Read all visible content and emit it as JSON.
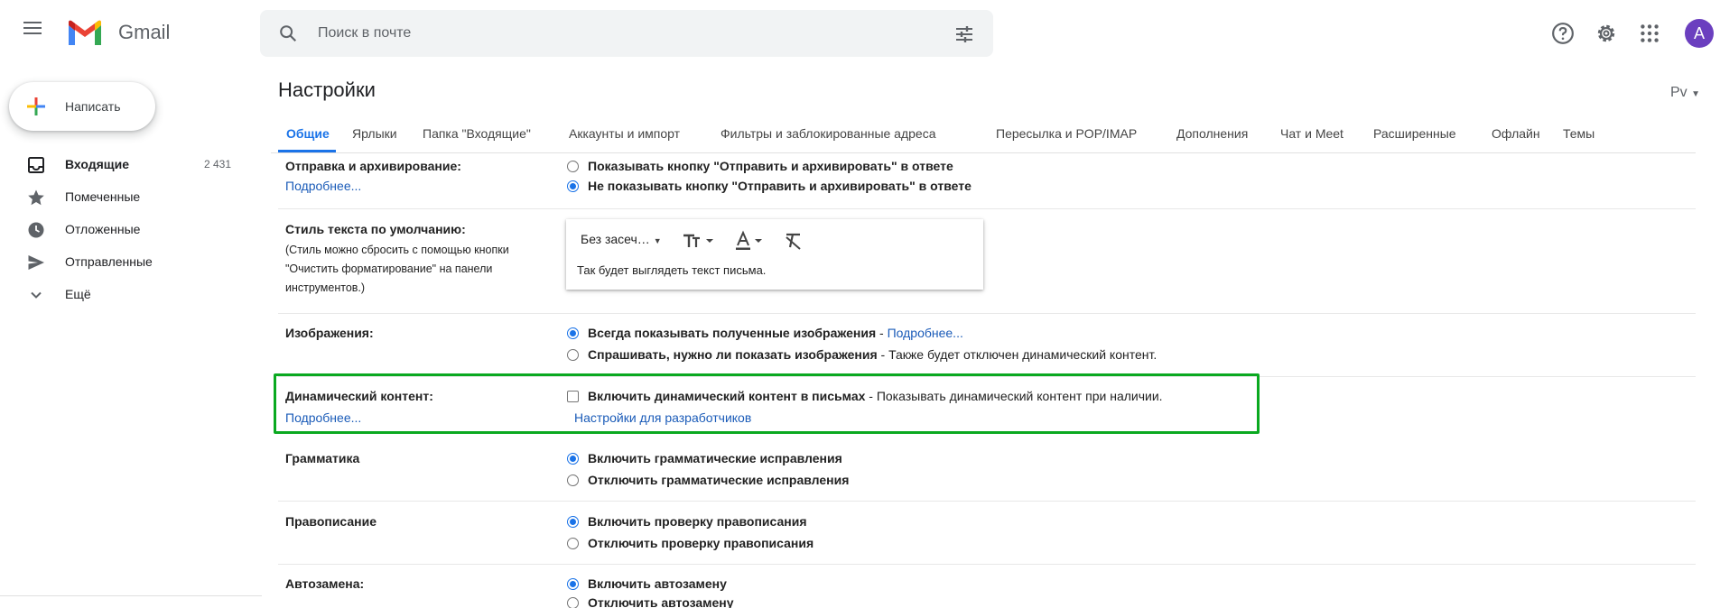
{
  "header": {
    "app_name": "Gmail",
    "search_placeholder": "Поиск в почте",
    "avatar_letter": "A"
  },
  "sidebar": {
    "compose_label": "Написать",
    "items": [
      {
        "label": "Входящие",
        "count": "2 431",
        "icon": "inbox-icon"
      },
      {
        "label": "Помеченные",
        "count": "",
        "icon": "star-icon"
      },
      {
        "label": "Отложенные",
        "count": "",
        "icon": "clock-icon"
      },
      {
        "label": "Отправленные",
        "count": "",
        "icon": "send-icon"
      },
      {
        "label": "Ещё",
        "count": "",
        "icon": "chevron-down-icon"
      }
    ]
  },
  "settings": {
    "title": "Настройки",
    "lang_toggle": "Рv",
    "tabs": [
      "Общие",
      "Ярлыки",
      "Папка \"Входящие\"",
      "Аккаунты и импорт",
      "Фильтры и заблокированные адреса",
      "Пересылка и POP/IMAP",
      "Дополнения",
      "Чат и Meet",
      "Расширенные",
      "Офлайн",
      "Темы"
    ],
    "active_tab": "Общие",
    "rows": {
      "send_archive": {
        "label": "Отправка и архивирование:",
        "link": "Подробнее...",
        "options": [
          "Показывать кнопку \"Отправить и архивировать\" в ответе",
          "Не показывать кнопку \"Отправить и архивировать\" в ответе"
        ],
        "selected": 1
      },
      "text_style": {
        "label": "Стиль текста по умолчанию:",
        "note_1": "(Стиль можно сбросить с помощью кнопки",
        "note_2": "\"Очистить форматирование\" на панели",
        "note_3": "инструментов.)",
        "font": "Без засеч…",
        "sample": "Так будет выглядеть текст письма."
      },
      "images": {
        "label": "Изображения:",
        "option_1_bold": "Всегда показывать полученные изображения",
        "option_1_sep": " - ",
        "option_1_link": "Подробнее...",
        "option_2_bold": "Спрашивать, нужно ли показать изображения",
        "option_2_rest": " - Также будет отключен динамический контент.",
        "selected": 0
      },
      "dynamic": {
        "label": "Динамический контент:",
        "link": "Подробнее...",
        "option_bold": "Включить динамический контент в письмах",
        "option_rest": " - Показывать динамический контент при наличии.",
        "checked": false,
        "dev_link": "Настройки для разработчиков"
      },
      "grammar": {
        "label": "Грамматика",
        "options": [
          "Включить грамматические исправления",
          "Отключить грамматические исправления"
        ],
        "selected": 0
      },
      "spelling": {
        "label": "Правописание",
        "options": [
          "Включить проверку правописания",
          "Отключить проверку правописания"
        ],
        "selected": 0
      },
      "autocorrect": {
        "label": "Автозамена:",
        "options": [
          "Включить автозамену",
          "Отключить автозамену"
        ],
        "selected": 0
      }
    }
  },
  "colors": {
    "accent": "#1a73e8",
    "link": "#1a5bb8",
    "highlight": "#0aa920",
    "avatar": "#6b3fbf"
  }
}
